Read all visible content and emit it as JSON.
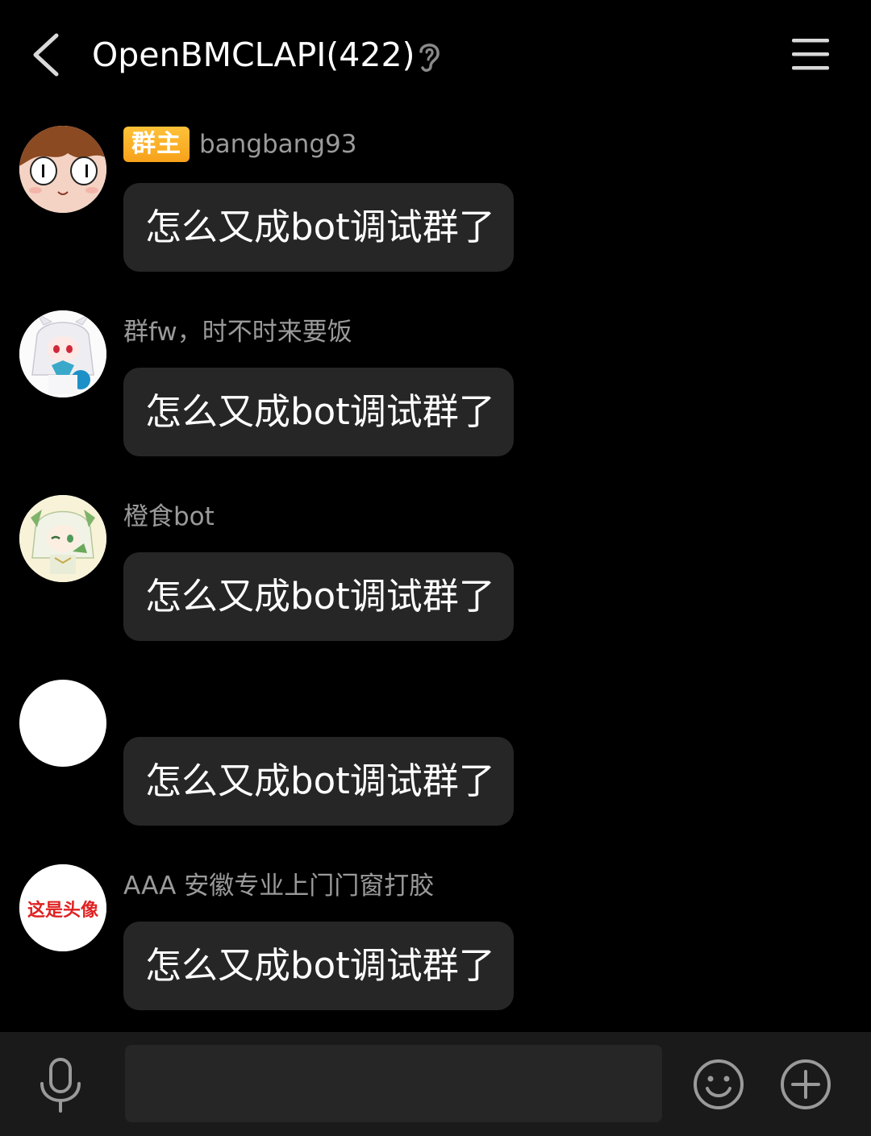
{
  "header": {
    "title": "OpenBMCLAPI(422)",
    "back_icon": "chevron-left-icon",
    "ear_icon": "ear-icon",
    "menu_icon": "hamburger-menu-icon"
  },
  "messages": [
    {
      "badge": "群主",
      "sender": "bangbang93",
      "text": "怎么又成bot调试群了"
    },
    {
      "sender": "群fw，时不时来要饭",
      "text": "怎么又成bot调试群了"
    },
    {
      "sender": "橙食bot",
      "text": "怎么又成bot调试群了"
    },
    {
      "sender": "",
      "text": "怎么又成bot调试群了"
    },
    {
      "sender": "AAA 安徽专业上门门窗打胶",
      "text": "怎么又成bot调试群了",
      "avatar_text": "这是头像"
    }
  ],
  "input_bar": {
    "text_value": "",
    "mic_icon": "microphone-icon",
    "emoji_icon": "smiley-icon",
    "plus_icon": "plus-circle-icon"
  },
  "colors": {
    "background": "#000000",
    "bubble": "#262626",
    "badge": "#f7a11a",
    "sender_text": "#9a9a9a",
    "input_bar": "#1a1a1a"
  }
}
